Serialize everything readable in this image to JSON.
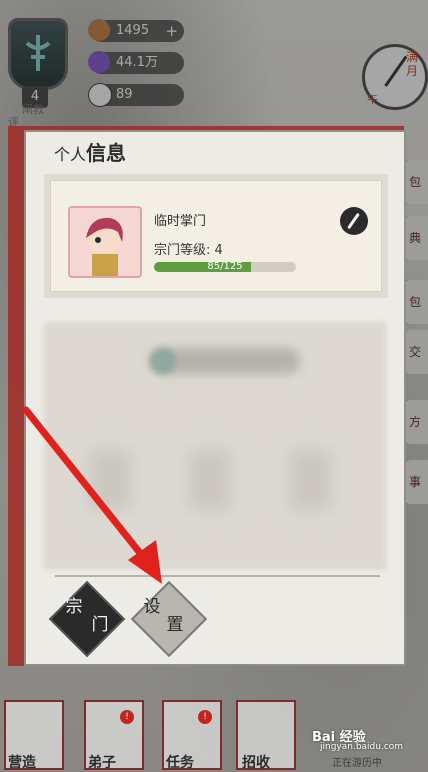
{
  "hud": {
    "sect_level": "4",
    "sect_name": "阐教",
    "side_label": "评",
    "resources": [
      {
        "icon": "gold-ingot-icon",
        "value": "1495",
        "has_plus": true
      },
      {
        "icon": "spirit-orb-icon",
        "value": "44.1万"
      },
      {
        "icon": "yin-yang-icon",
        "value": "89"
      }
    ],
    "clock_label": "满月",
    "clock_sub": "午"
  },
  "panel": {
    "title_a": "个人",
    "title_b": "信息",
    "player": {
      "name": "临时掌门",
      "level_label": "宗门等级:",
      "level_value": "4",
      "xp_text": "85/125",
      "xp_fraction": 0.68
    },
    "buttons": {
      "sect_a": "宗",
      "sect_b": "门",
      "settings_a": "设",
      "settings_b": "置"
    }
  },
  "right_side": [
    "包",
    "典",
    "包",
    "交",
    "方",
    "事"
  ],
  "bottom_nav": [
    {
      "label": "营造",
      "badge": ""
    },
    {
      "label": "弟子",
      "badge": "!"
    },
    {
      "label": "任务",
      "badge": "!"
    },
    {
      "label": "招收",
      "badge": ""
    }
  ],
  "status": "正在游历中",
  "watermark": {
    "main": "Bai 经验",
    "sub": "jingyan.baidu.com"
  },
  "colors": {
    "accent_red": "#c0261e",
    "xp_green": "#5e9e3e"
  }
}
